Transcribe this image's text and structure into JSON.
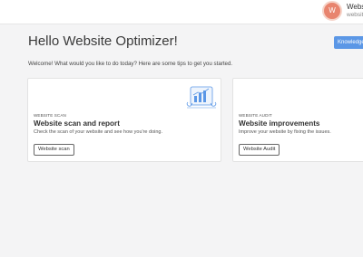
{
  "header": {
    "avatar_initial": "W",
    "user_name": "Webs",
    "user_sub": "websit"
  },
  "main": {
    "title": "Hello Website Optimizer!",
    "knowledge_button": "Knowledge",
    "welcome": "Welcome! What would you like to do today? Here are some tips to get you started."
  },
  "cards": [
    {
      "eyebrow": "WEBSITE SCAN",
      "title": "Website scan and report",
      "description": "Check the scan of your website and see how you're doing.",
      "button": "Website scan",
      "icon": "report-illustration-icon"
    },
    {
      "eyebrow": "WEBSITE AUDIT",
      "title": "Website improvements",
      "description": "Improve your website by fixing the issues.",
      "button": "Website Audit"
    }
  ],
  "colors": {
    "accent": "#5b97e6",
    "avatar": "#e8846e",
    "background": "#f4f4f5"
  }
}
